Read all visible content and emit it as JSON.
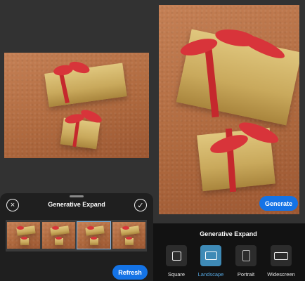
{
  "left_panel": {
    "title": "Generative Expand",
    "close_icon": "×",
    "confirm_icon": "✓",
    "refresh_label": "Refresh",
    "thumbnails_count": 4,
    "selected_thumbnail": 3
  },
  "right_panel": {
    "generate_label": "Generate",
    "title": "Generative Expand",
    "aspect_options": [
      {
        "label": "Square",
        "icon": "square-icon"
      },
      {
        "label": "Landscape",
        "icon": "landscape-icon"
      },
      {
        "label": "Portrait",
        "icon": "portrait-icon"
      },
      {
        "label": "Widescreen",
        "icon": "widescreen-icon"
      }
    ],
    "selected_aspect": "Landscape"
  },
  "colors": {
    "accent": "#1473e6",
    "selected_aspect": "#3e8ab6",
    "selected_label": "#56a7e0",
    "background": "#323232"
  }
}
